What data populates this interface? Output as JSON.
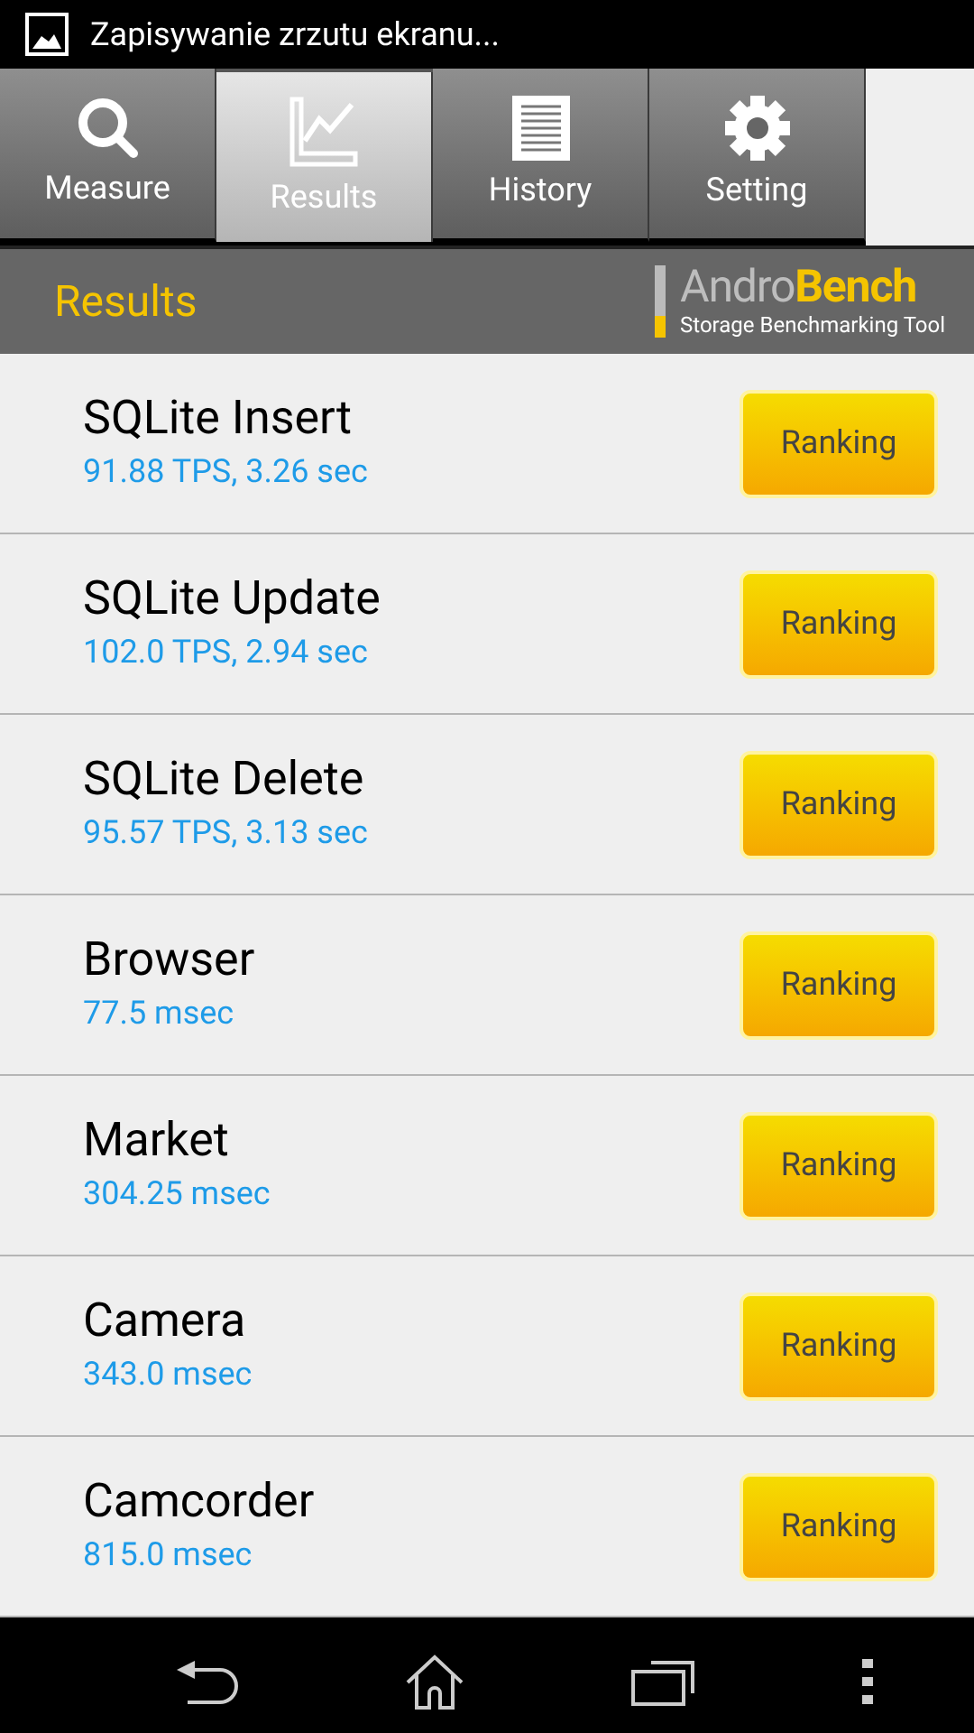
{
  "status_bar": {
    "notification": "Zapisywanie zrzutu ekranu..."
  },
  "tabs": [
    {
      "label": "Measure",
      "selected": false
    },
    {
      "label": "Results",
      "selected": true
    },
    {
      "label": "History",
      "selected": false
    },
    {
      "label": "Setting",
      "selected": false
    }
  ],
  "header": {
    "title": "Results",
    "logo": {
      "part1": "Andro",
      "part2": "Bench",
      "tagline": "Storage Benchmarking Tool"
    }
  },
  "results": [
    {
      "name": "SQLite Insert",
      "value": "91.88 TPS, 3.26 sec",
      "button": "Ranking"
    },
    {
      "name": "SQLite Update",
      "value": "102.0 TPS, 2.94 sec",
      "button": "Ranking"
    },
    {
      "name": "SQLite Delete",
      "value": "95.57 TPS, 3.13 sec",
      "button": "Ranking"
    },
    {
      "name": "Browser",
      "value": "77.5 msec",
      "button": "Ranking"
    },
    {
      "name": "Market",
      "value": "304.25 msec",
      "button": "Ranking"
    },
    {
      "name": "Camera",
      "value": "343.0 msec",
      "button": "Ranking"
    },
    {
      "name": "Camcorder",
      "value": "815.0 msec",
      "button": "Ranking"
    }
  ]
}
